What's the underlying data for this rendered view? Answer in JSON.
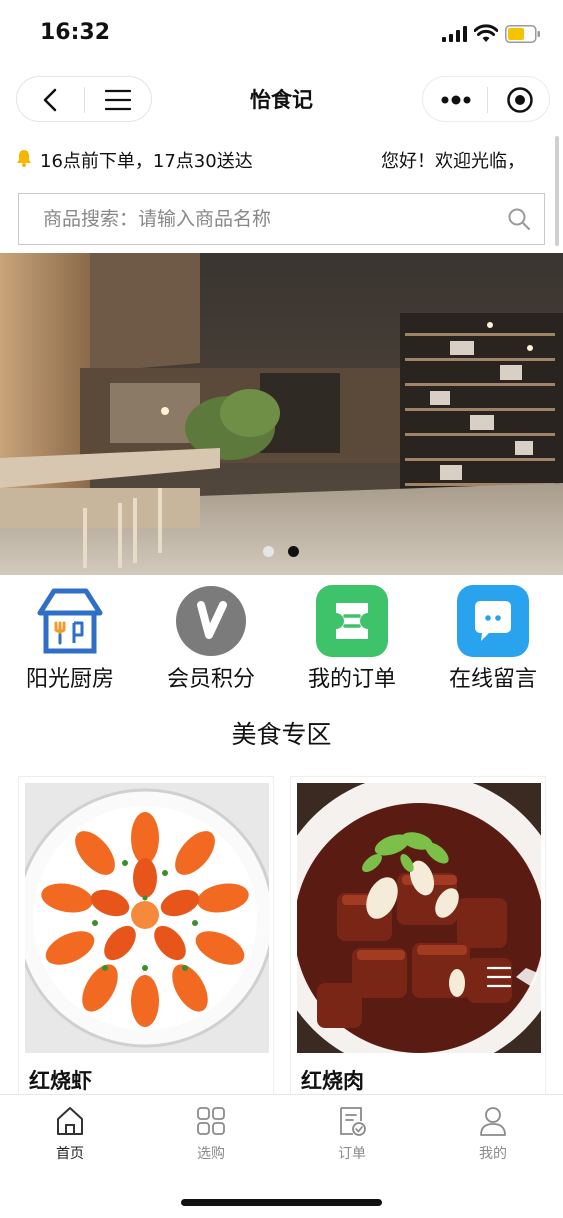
{
  "status_bar": {
    "time": "16:32"
  },
  "nav": {
    "title": "怡食记",
    "back_icon": "chevron-left-icon",
    "menu_icon": "hamburger-icon",
    "more_icon": "more-dots-icon",
    "close_icon": "target-circle-icon"
  },
  "notice": {
    "icon": "bell-icon",
    "text": "16点前下单，17点30送达",
    "welcome": "您好！欢迎光临，"
  },
  "search": {
    "placeholder": "商品搜索：请输入商品名称",
    "value": "",
    "icon": "search-icon"
  },
  "banner": {
    "dots_total": 2,
    "active_dot": 2
  },
  "quick_menu": [
    {
      "label": "阳光厨房",
      "icon": "kitchen-house-icon",
      "color": "#2f6fc7"
    },
    {
      "label": "会员积分",
      "icon": "v-member-icon",
      "color": "#7b7b7b"
    },
    {
      "label": "我的订单",
      "icon": "order-ticket-icon",
      "color": "#3ec26a"
    },
    {
      "label": "在线留言",
      "icon": "chat-bubble-icon",
      "color": "#2aa3ef"
    }
  ],
  "section": {
    "title": "美食专区"
  },
  "products": [
    {
      "name": "红烧虾"
    },
    {
      "name": "红烧肉"
    }
  ],
  "tabs": [
    {
      "label": "首页",
      "icon": "home-icon",
      "active": true
    },
    {
      "label": "选购",
      "icon": "grid-icon",
      "active": false
    },
    {
      "label": "订单",
      "icon": "order-doc-icon",
      "active": false
    },
    {
      "label": "我的",
      "icon": "user-icon",
      "active": false
    }
  ],
  "colors": {
    "accent_yellow": "#f5b700",
    "tab_inactive": "#8a8a8a",
    "tab_active": "#222222"
  }
}
